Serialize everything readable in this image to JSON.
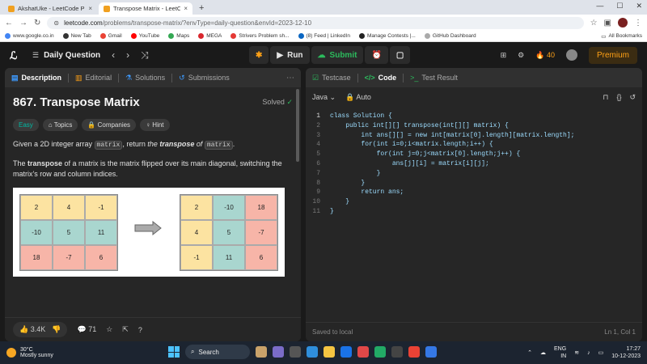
{
  "browser": {
    "tabs": [
      {
        "label": "AkshatUke - LeetCode Profile",
        "active": false
      },
      {
        "label": "Transpose Matrix - LeetCode",
        "active": true
      }
    ],
    "url_host": "leetcode.com",
    "url_path": "/problems/transpose-matrix/?envType=daily-question&envId=2023-12-10",
    "bookmarks": [
      "www.google.co.in",
      "New Tab",
      "Gmail",
      "YouTube",
      "Maps",
      "MEGA",
      "Strivers Problem sh...",
      "(8) Feed | LinkedIn",
      "Manage Contests |...",
      "GitHub Dashboard"
    ],
    "all_bookmarks": "All Bookmarks"
  },
  "nav": {
    "title": "Daily Question",
    "run": "Run",
    "submit": "Submit",
    "streak": "40",
    "premium": "Premium"
  },
  "left": {
    "tabs": [
      "Description",
      "Editorial",
      "Solutions",
      "Submissions"
    ],
    "title": "867. Transpose Matrix",
    "solved": "Solved",
    "tags": [
      "Easy",
      "Topics",
      "Companies",
      "Hint"
    ],
    "p1_pre": "Given a 2D integer array ",
    "p1_code1": "matrix",
    "p1_mid": ", return ",
    "p1_em1": "the ",
    "p1_em2": "transpose",
    "p1_em3": " of ",
    "p1_code2": "matrix",
    "p1_post": ".",
    "p2_pre": "The ",
    "p2_bold": "transpose",
    "p2_post": " of a matrix is the matrix flipped over its main diagonal, switching the matrix's row and column indices.",
    "matrix_a": [
      "2",
      "4",
      "-1",
      "-10",
      "5",
      "11",
      "18",
      "-7",
      "6"
    ],
    "matrix_b": [
      "2",
      "-10",
      "18",
      "4",
      "5",
      "-7",
      "-1",
      "11",
      "6"
    ],
    "likes": "3.4K",
    "comments": "71"
  },
  "right": {
    "tabs": [
      "Testcase",
      "Code",
      "Test Result"
    ],
    "language": "Java",
    "mode": "Auto",
    "code_lines": [
      "class Solution {",
      "    public int[][] transpose(int[][] matrix) {",
      "        int ans[][] = new int[matrix[0].length][matrix.length];",
      "        for(int i=0;i<matrix.length;i++) {",
      "            for(int j=0;j<matrix[0].length;j++) {",
      "                ans[j][i] = matrix[i][j];",
      "            }",
      "        }",
      "        return ans;",
      "    }",
      "}"
    ],
    "status_left": "Saved to local",
    "status_right": "Ln 1, Col 1"
  },
  "taskbar": {
    "temp": "30°C",
    "weather": "Mostly sunny",
    "search": "Search",
    "lang1": "ENG",
    "lang2": "IN",
    "time": "17:27",
    "date": "10-12-2023"
  }
}
